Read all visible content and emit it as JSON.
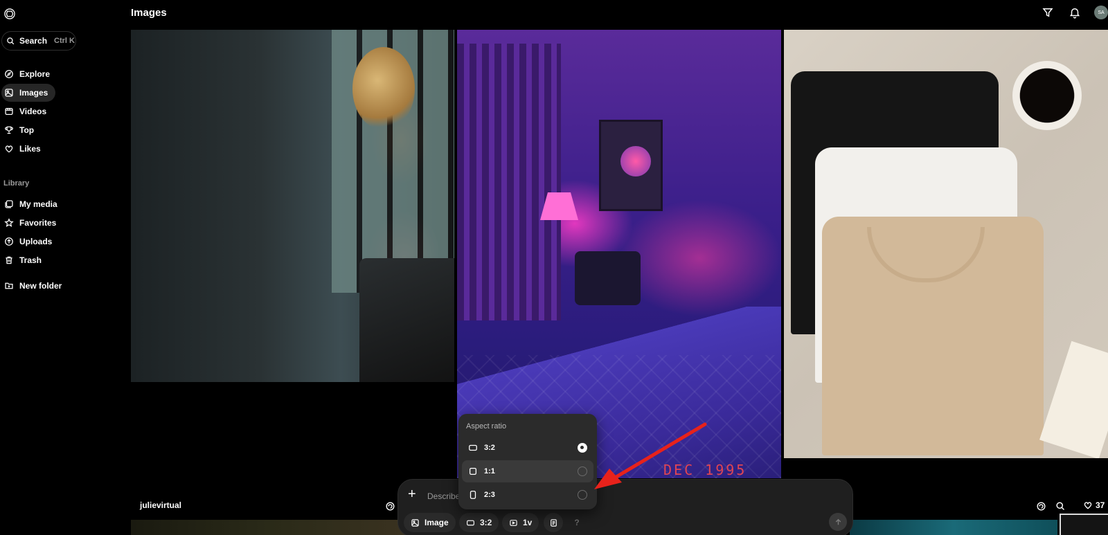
{
  "header": {
    "title": "Images",
    "avatar_initials": "SA"
  },
  "sidebar": {
    "search_label": "Search",
    "search_shortcut": "Ctrl K",
    "nav": [
      {
        "label": "Explore",
        "icon": "compass-icon"
      },
      {
        "label": "Images",
        "icon": "image-icon",
        "active": true
      },
      {
        "label": "Videos",
        "icon": "video-icon"
      },
      {
        "label": "Top",
        "icon": "trophy-icon"
      },
      {
        "label": "Likes",
        "icon": "heart-icon"
      }
    ],
    "library_label": "Library",
    "library": [
      {
        "label": "My media",
        "icon": "media-icon"
      },
      {
        "label": "Favorites",
        "icon": "star-icon"
      },
      {
        "label": "Uploads",
        "icon": "upload-icon"
      },
      {
        "label": "Trash",
        "icon": "trash-icon"
      }
    ],
    "new_folder": "New folder"
  },
  "gallery": {
    "room_stamp": "DEC 1995",
    "row_user": "julievirtual",
    "likes_count": "37"
  },
  "composer": {
    "placeholder": "Describe",
    "mode_label": "Image",
    "ratio_label": "3:2",
    "count_label": "1v",
    "help_label": "?"
  },
  "aspect_popup": {
    "title": "Aspect ratio",
    "options": [
      {
        "label": "3:2",
        "selected": true
      },
      {
        "label": "1:1",
        "selected": false
      },
      {
        "label": "2:3",
        "selected": false
      }
    ]
  },
  "colors": {
    "annotation_arrow": "#e8221b",
    "background": "#000000",
    "popup_bg": "#2b2b2b"
  }
}
